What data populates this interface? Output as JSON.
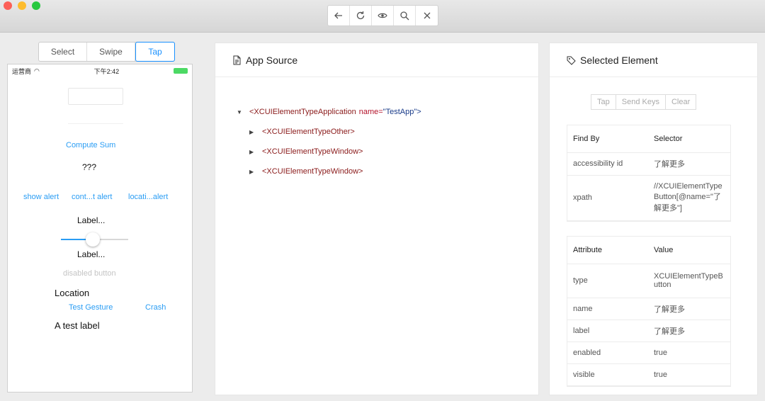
{
  "toolbar": {
    "back_icon": "arrow-left-icon",
    "refresh_icon": "refresh-icon",
    "eye_icon": "eye-icon",
    "search_icon": "search-icon",
    "close_icon": "close-icon"
  },
  "modes": [
    "Select",
    "Swipe",
    "Tap"
  ],
  "phone": {
    "carrier": "运营商",
    "time": "下午2:42",
    "compute_sum": "Compute Sum",
    "result": "???",
    "alerts": [
      "show alert",
      "cont...t alert",
      "locati...alert"
    ],
    "label1": "Label...",
    "label2": "Label...",
    "disabled_button": "disabled button",
    "location": "Location",
    "test_gesture": "Test Gesture",
    "crash": "Crash",
    "test_label": "A test label",
    "slider_value": 0.4
  },
  "source": {
    "title": "App Source",
    "root": {
      "tag": "<XCUIElementTypeApplication",
      "attr": "name=",
      "value": "\"TestApp\">"
    },
    "children": [
      "<XCUIElementTypeOther>",
      "<XCUIElementTypeWindow>",
      "<XCUIElementTypeWindow>"
    ]
  },
  "selected": {
    "title": "Selected Element",
    "actions": [
      "Tap",
      "Send Keys",
      "Clear"
    ],
    "find_headers": [
      "Find By",
      "Selector"
    ],
    "find_rows": [
      [
        "accessibility id",
        "了解更多"
      ],
      [
        "xpath",
        "//XCUIElementTypeButton[@name=\"了解更多\"]"
      ]
    ],
    "attr_headers": [
      "Attribute",
      "Value"
    ],
    "attr_rows": [
      [
        "type",
        "XCUIElementTypeButton"
      ],
      [
        "name",
        "了解更多"
      ],
      [
        "label",
        "了解更多"
      ],
      [
        "enabled",
        "true"
      ],
      [
        "visible",
        "true"
      ]
    ]
  }
}
